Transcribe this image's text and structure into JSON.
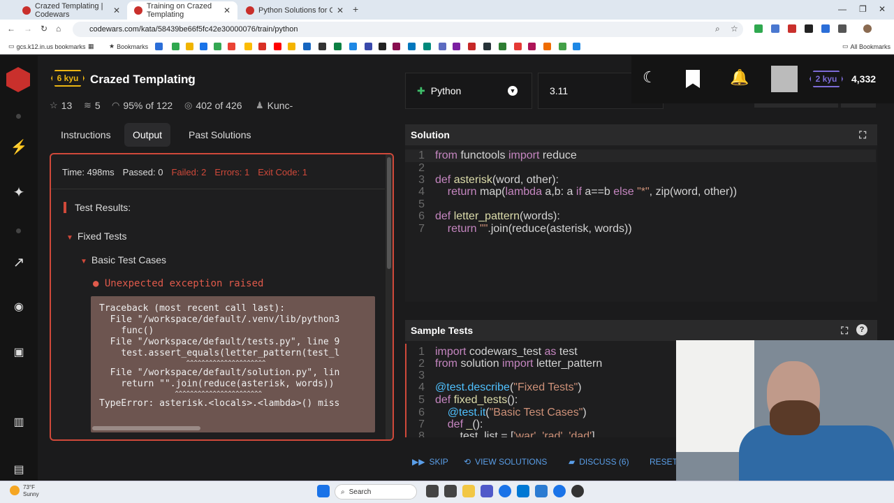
{
  "browser": {
    "tabs": [
      {
        "title": "Crazed Templating | Codewars",
        "close": "✕"
      },
      {
        "title": "Training on Crazed Templating",
        "close": "✕"
      },
      {
        "title": "Python Solutions for Crazed Te",
        "close": "✕"
      }
    ],
    "new_tab": "+",
    "url": "codewars.com/kata/58439be66f5fc42e30000076/train/python",
    "bookmarks_label": "Bookmarks",
    "gcs_label": "gcs.k12.in.us bookmarks",
    "all_bookmarks": "All Bookmarks"
  },
  "kata": {
    "rank": "6 kyu",
    "title": "Crazed Templating",
    "stars": "13",
    "collections": "5",
    "satisfaction": "95% of 122",
    "completions": "402 of 426",
    "author": "Kunc-"
  },
  "tabs": [
    "Instructions",
    "Output",
    "Past Solutions"
  ],
  "output": {
    "time": "Time: 498ms",
    "passed": "Passed: 0",
    "failed": "Failed: 2",
    "errors": "Errors: 1",
    "exit": "Exit Code: 1",
    "test_results": "Test Results:",
    "fixed_tests": "Fixed Tests",
    "basic_cases": "Basic Test Cases",
    "exception": "Unexpected exception raised",
    "traceback": [
      "Traceback (most recent call last):",
      "  File \"/workspace/default/.venv/lib/python3",
      "    func()",
      "  File \"/workspace/default/tests.py\", line 9",
      "    test.assert_equals(letter_pattern(test_l",
      "                       ^^^^^^^^^^^^^^^^^^^^^",
      "  File \"/workspace/default/solution.py\", lin",
      "    return \"\".join(reduce(asterisk, words))",
      "                    ^^^^^^^^^^^^^^^^^^^^^^^",
      "TypeError: asterisk.<locals>.<lambda>() miss"
    ]
  },
  "editor": {
    "language": "Python",
    "version": "3.11",
    "solution_title": "Solution",
    "sample_title": "Sample Tests"
  },
  "user": {
    "rank": "2 kyu",
    "honor": "4,332"
  },
  "actions": {
    "skip": "SKIP",
    "view_solutions": "VIEW SOLUTIONS",
    "discuss": "DISCUSS (6)",
    "reset": "RESET"
  },
  "taskbar": {
    "temp": "73°F",
    "weather": "Sunny",
    "search": "Search"
  },
  "colors": {
    "accent_red": "#d0493a",
    "kyu_yellow": "#ecb613",
    "user_rank_purple": "#7c6bd6",
    "link_blue": "#5a9ee8"
  }
}
